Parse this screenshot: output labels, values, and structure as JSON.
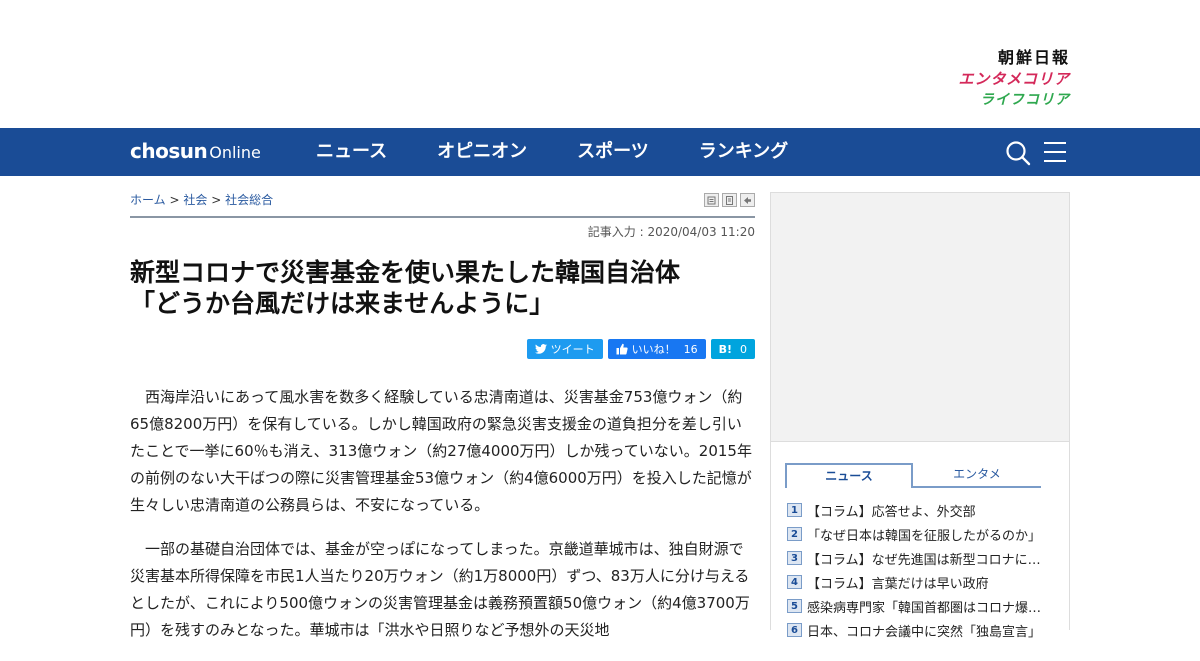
{
  "brands": {
    "main": "朝鮮日報",
    "entame": "エンタメコリア",
    "life": "ライフコリア"
  },
  "nav": {
    "logo_bold": "chosun",
    "logo_light": "Online",
    "items": [
      "ニュース",
      "オピニオン",
      "スポーツ",
      "ランキング"
    ]
  },
  "breadcrumb": {
    "home": "ホーム",
    "sep": ">",
    "section": "社会",
    "subsection": "社会総合"
  },
  "article": {
    "date": "記事入力 : 2020/04/03 11:20",
    "headline_line1": "新型コロナで災害基金を使い果たした韓国自治体",
    "headline_line2": "「どうか台風だけは来ませんように」",
    "paragraphs": [
      "西海岸沿いにあって風水害を数多く経験している忠清南道は、災害基金753億ウォン（約65億8200万円）を保有している。しかし韓国政府の緊急災害支援金の道負担分を差し引いたことで一挙に60％も消え、313億ウォン（約27億4000万円）しか残っていない。2015年の前例のない大干ばつの際に災害管理基金53億ウォン（約4億6000万円）を投入した記憶が生々しい忠清南道の公務員らは、不安になっている。",
      "一部の基礎自治団体では、基金が空っぽになってしまった。京畿道華城市は、独自財源で災害基本所得保障を市民1人当たり20万ウォン（約1万8000円）ずつ、83万人に分け与えるとしたが、これにより500億ウォンの災害管理基金は義務預置額50億ウォン（約4億3700万円）を残すのみとなった。華城市は「洪水や日照りなど予想外の天災地"
    ]
  },
  "share": {
    "tweet": "ツイート",
    "like": "いいね！",
    "like_count": "16",
    "hatena": "B!",
    "hatena_count": "0"
  },
  "sidebar": {
    "tabs": [
      "ニュース",
      "エンタメ"
    ],
    "ranking": [
      {
        "num": "1",
        "title": "【コラム】応答せよ、外交部"
      },
      {
        "num": "2",
        "title": "「なぜ日本は韓国を征服したがるのか」"
      },
      {
        "num": "3",
        "title": "【コラム】なぜ先進国は新型コロナに…"
      },
      {
        "num": "4",
        "title": "【コラム】言葉だけは早い政府"
      },
      {
        "num": "5",
        "title": "感染病専門家「韓国首都圏はコロナ爆…"
      },
      {
        "num": "6",
        "title": "日本、コロナ会議中に突然「独島宣言」"
      }
    ]
  },
  "colors": {
    "nav_bg": "#1a4c96",
    "accent_red": "#d4295a",
    "accent_green": "#2fa84f",
    "twitter": "#1d9bf0",
    "facebook": "#1877f2",
    "hatena": "#00a4de"
  }
}
